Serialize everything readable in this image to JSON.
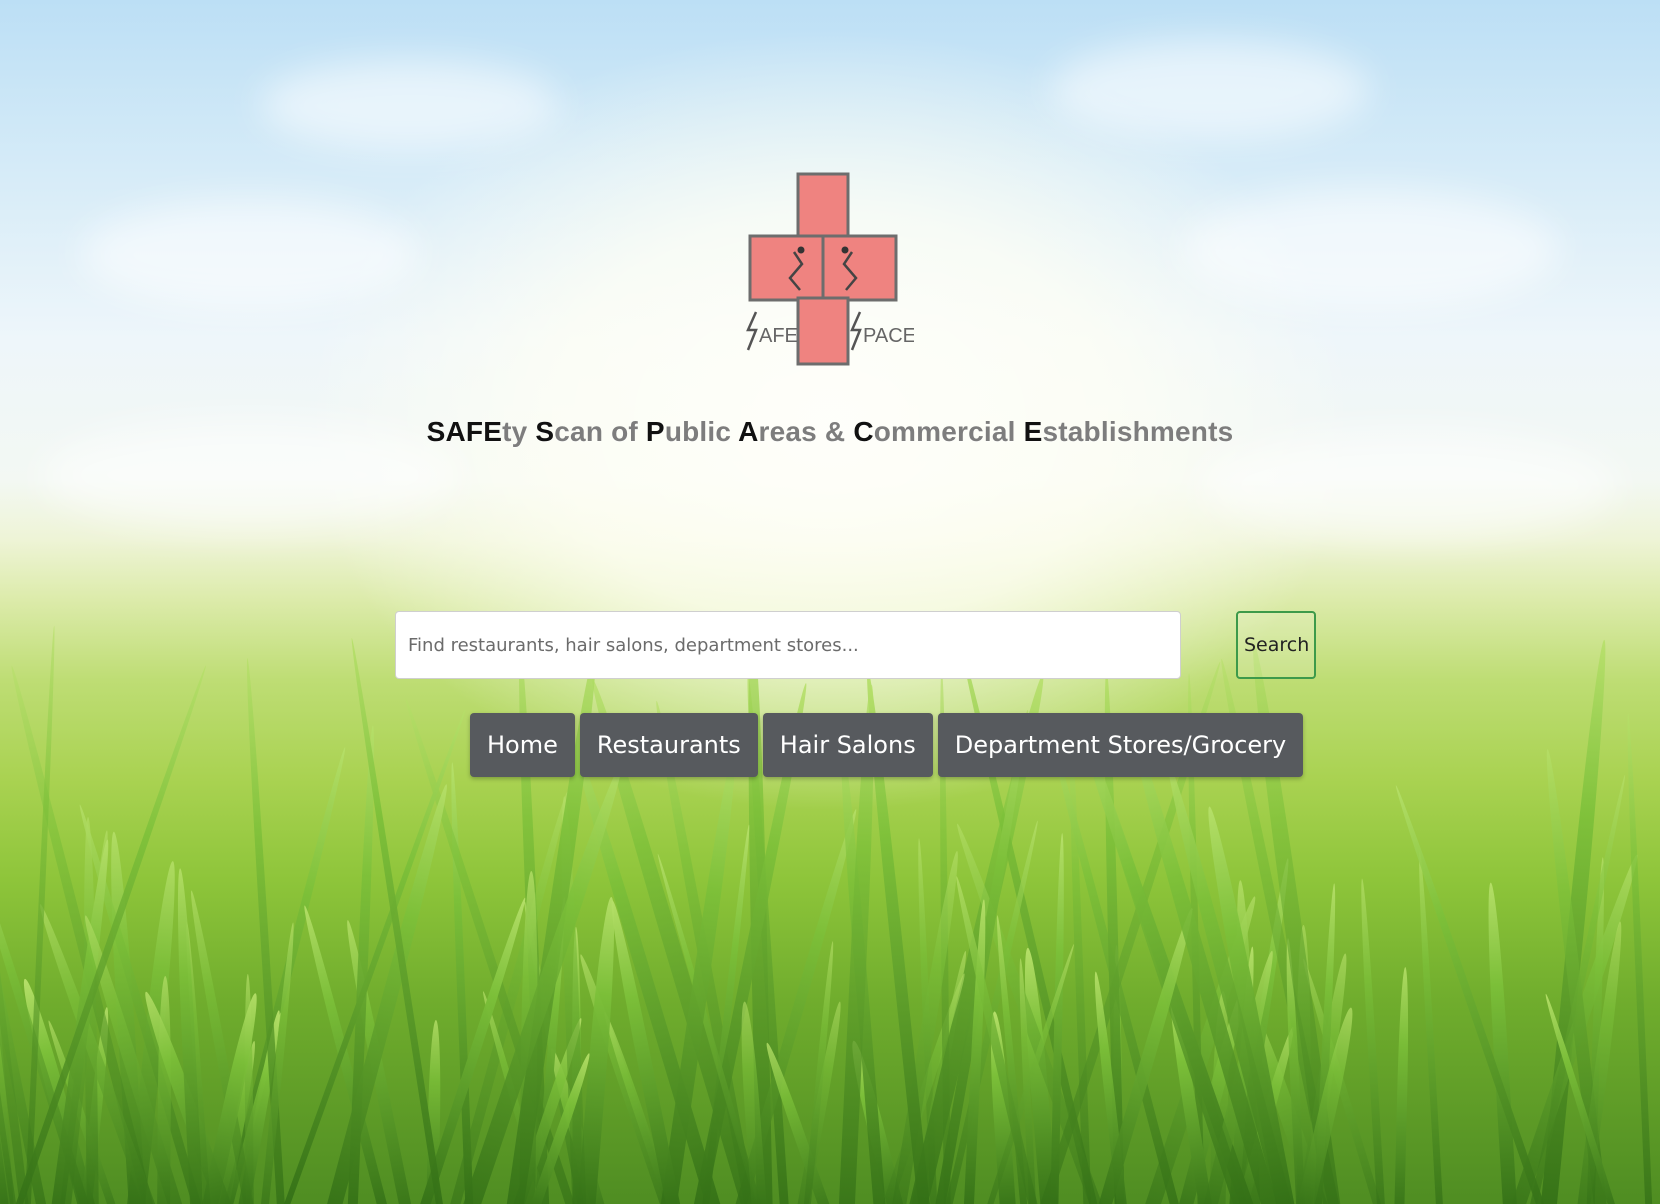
{
  "logo": {
    "left_text": "AFE",
    "right_text": "PACE",
    "fill_color": "#ef8380",
    "stroke_color": "#6d6d6d"
  },
  "tagline": [
    {
      "text": "SAFE",
      "cap": true
    },
    {
      "text": "ty ",
      "cap": false
    },
    {
      "text": "S",
      "cap": true
    },
    {
      "text": "can of ",
      "cap": false
    },
    {
      "text": "P",
      "cap": true
    },
    {
      "text": "ublic ",
      "cap": false
    },
    {
      "text": "A",
      "cap": true
    },
    {
      "text": "reas & ",
      "cap": false
    },
    {
      "text": "C",
      "cap": true
    },
    {
      "text": "ommercial ",
      "cap": false
    },
    {
      "text": "E",
      "cap": true
    },
    {
      "text": "stablishments",
      "cap": false
    }
  ],
  "search": {
    "placeholder": "Find restaurants, hair salons, department stores...",
    "value": "",
    "button_label": "Search",
    "button_border_color": "#3d9a4a"
  },
  "nav": {
    "items": [
      {
        "label": "Home"
      },
      {
        "label": "Restaurants"
      },
      {
        "label": "Hair Salons"
      },
      {
        "label": "Department Stores/Grocery"
      }
    ],
    "button_color": "#575a5e"
  }
}
